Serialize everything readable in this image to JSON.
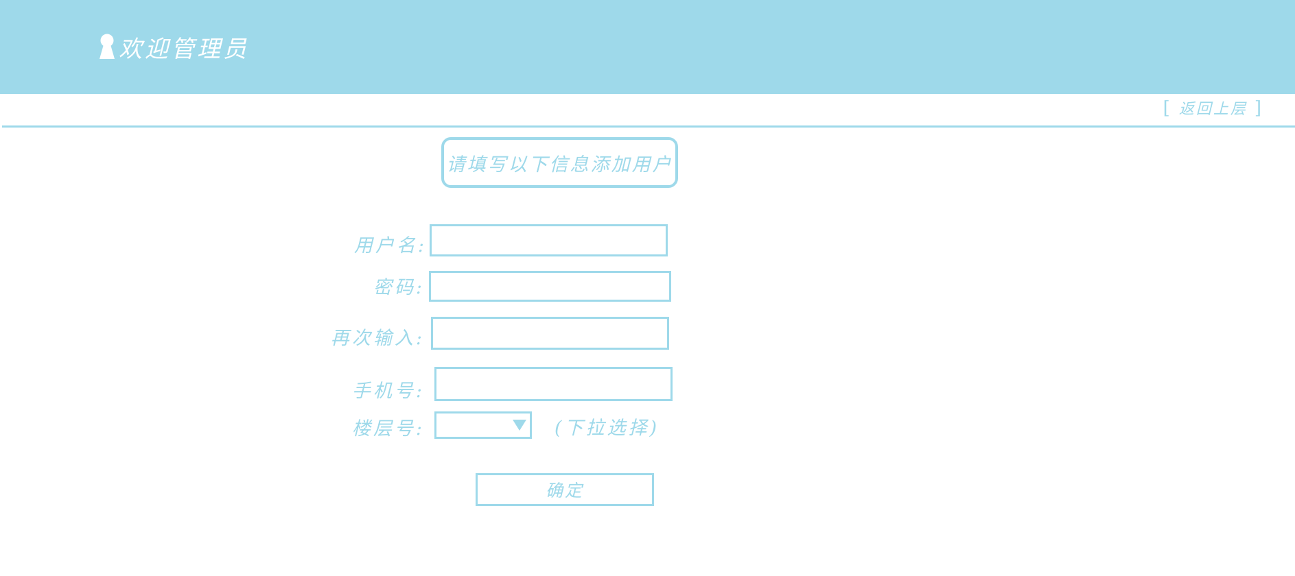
{
  "colors": {
    "accent": "#9ed9ea",
    "header_text": "#ffffff",
    "background": "#ffffff"
  },
  "header": {
    "icon": "user-icon",
    "title": "欢迎管理员"
  },
  "nav": {
    "back_label": "返回上层",
    "bracket_open": "[",
    "bracket_close": "]"
  },
  "form": {
    "heading": "请填写以下信息添加用户",
    "fields": {
      "username": {
        "label": "用户名:",
        "value": "",
        "placeholder": ""
      },
      "password": {
        "label": "密码:",
        "value": "",
        "placeholder": ""
      },
      "confirm_password": {
        "label": "再次输入:",
        "value": "",
        "placeholder": ""
      },
      "phone": {
        "label": "手机号:",
        "value": "",
        "placeholder": ""
      },
      "floor": {
        "label": "楼层号:",
        "selected": "",
        "icon": "dropdown-arrow-icon",
        "hint": "(下拉选择)"
      }
    },
    "submit_label": "确定"
  }
}
